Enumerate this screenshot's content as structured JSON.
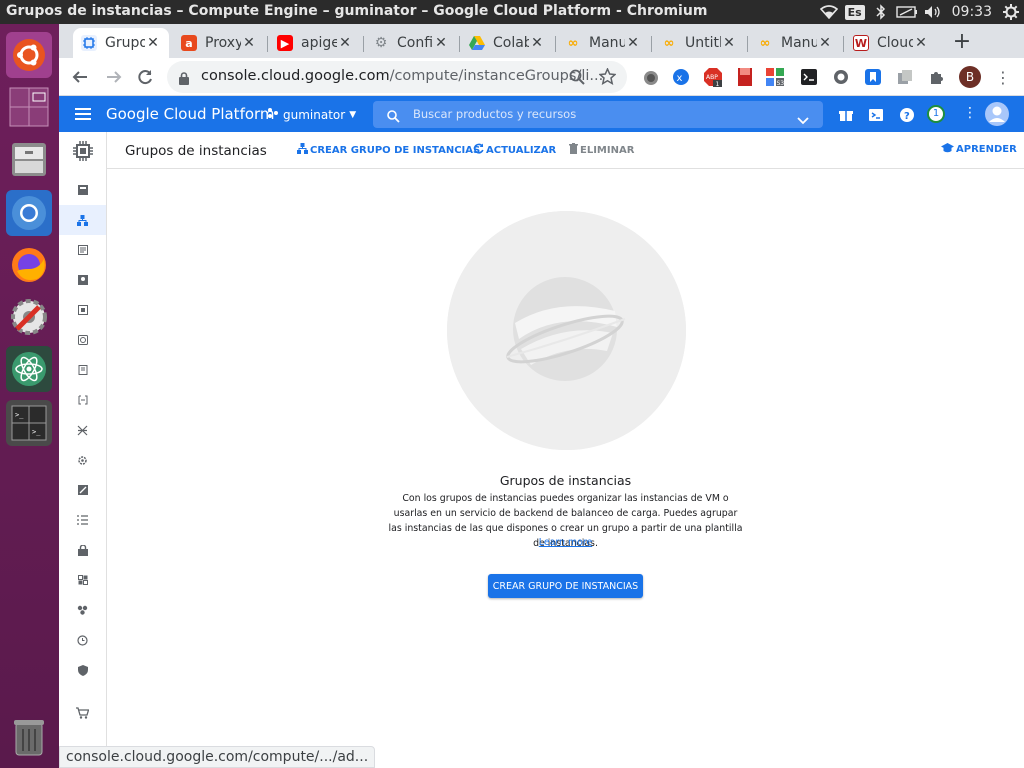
{
  "os": {
    "window_title": "Grupos de instancias – Compute Engine – guminator – Google Cloud Platform - Chromium",
    "keyboard_layout": "Es",
    "time": "09:33"
  },
  "browser": {
    "tabs": [
      {
        "label": "Grupos de instancias",
        "icon": "gcp-icon",
        "active": true
      },
      {
        "label": "Proxy",
        "icon": "apigee-icon"
      },
      {
        "label": "apigee",
        "icon": "youtube-icon"
      },
      {
        "label": "Configuración",
        "icon": "gear-icon"
      },
      {
        "label": "Colab",
        "icon": "drive-icon"
      },
      {
        "label": "Manual",
        "icon": "colab-icon"
      },
      {
        "label": "Untitled",
        "icon": "colab-icon"
      },
      {
        "label": "Manual",
        "icon": "colab-icon"
      },
      {
        "label": "Cloud",
        "icon": "gitlab-icon"
      }
    ],
    "url_host": "console.cloud.google.com",
    "url_path": "/compute/instanceGroups/li...",
    "status_url": "console.cloud.google.com/compute/.../ad..."
  },
  "gcp": {
    "brand": "Google Cloud Platform",
    "project": "guminator",
    "search_placeholder": "Buscar productos y recursos",
    "notifications_count": "1",
    "account_initial": "B"
  },
  "page": {
    "title": "Grupos de instancias",
    "actions": {
      "create": "CREAR GRUPO DE INSTANCIAS",
      "refresh": "ACTUALIZAR",
      "delete": "ELIMINAR",
      "learn": "APRENDER"
    },
    "empty": {
      "title": "Grupos de instancias",
      "description": "Con los grupos de instancias puedes organizar las instancias de VM o usarlas en un servicio de backend de balanceo de carga. Puedes agrupar las instancias de las que dispones o crear un grupo a partir de una plantilla de instancias.",
      "link": "Learn more",
      "button": "CREAR GRUPO DE INSTANCIAS"
    }
  },
  "colors": {
    "gcp_blue": "#1a73e8",
    "launcher": "#6e1f5b",
    "topbar": "#2b2b2b"
  }
}
